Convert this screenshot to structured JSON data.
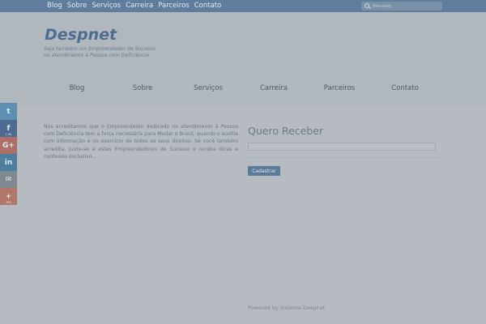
{
  "topbar": {
    "nav": [
      "Blog",
      "Sobre",
      "Serviços",
      "Carreira",
      "Parceiros",
      "Contato"
    ],
    "search_placeholder": "Procurar"
  },
  "header": {
    "logo": "Despnet",
    "tagline_line1": "Seja também um Empreendedor de Sucesso",
    "tagline_line2": "no atendimento à Pessoa com Deficiência"
  },
  "main_nav": [
    "Blog",
    "Sobre",
    "Serviços",
    "Carreira",
    "Parceiros",
    "Contato"
  ],
  "intro_text": "Nós acreditamos que o Empreendedor dedicado no atendimento à Pessoa com Deficiência tem a força necessária para Mudar o Brasil, quando o auxilia com informação e no exercício de todos os seus direitos. Se você também acredita, junte-se à estes Empreendedores de Sucesso e receba dicas e conteúdo exclusivo...",
  "form": {
    "title": "Quero Receber",
    "button_label": "Cadastrar"
  },
  "footer": {
    "text": "Powered by Sistema Despnet"
  },
  "share": [
    {
      "icon": "twitter-icon",
      "glyph": "t",
      "count": ""
    },
    {
      "icon": "facebook-icon",
      "glyph": "f",
      "count": "1.9K"
    },
    {
      "icon": "google-plus-icon",
      "glyph": "G+",
      "count": ""
    },
    {
      "icon": "linkedin-icon",
      "glyph": "in",
      "count": ""
    },
    {
      "icon": "email-icon",
      "glyph": "✉",
      "count": ""
    },
    {
      "icon": "more-icon",
      "glyph": "+",
      "count": "360"
    }
  ],
  "colors": {
    "topbar": "#5f7d9c",
    "logo": "#4e6e91",
    "button": "#5b7b9b"
  }
}
